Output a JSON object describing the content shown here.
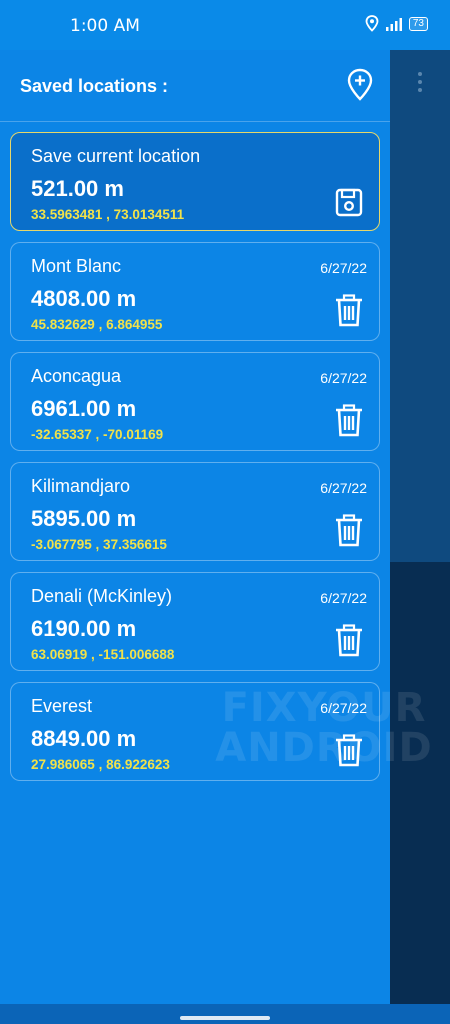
{
  "status_bar": {
    "time": "1:00 AM",
    "battery": "73",
    "icons": [
      "location-icon",
      "signal-icon",
      "battery-icon"
    ]
  },
  "drawer": {
    "title": "Saved locations :",
    "add_icon": "add-location-icon"
  },
  "current": {
    "name": "Save current location",
    "altitude": "521.00 m",
    "coords": "33.5963481 , 73.0134511",
    "action_icon": "save-icon"
  },
  "locations": [
    {
      "name": "Mont Blanc",
      "altitude": "4808.00 m",
      "coords": "45.832629 , 6.864955",
      "date": "6/27/22"
    },
    {
      "name": "Aconcagua",
      "altitude": "6961.00 m",
      "coords": "-32.65337 , -70.01169",
      "date": "6/27/22"
    },
    {
      "name": "Kilimandjaro",
      "altitude": "5895.00 m",
      "coords": "-3.067795 , 37.356615",
      "date": "6/27/22"
    },
    {
      "name": "Denali (McKinley)",
      "altitude": "6190.00 m",
      "coords": "63.06919 , -151.006688",
      "date": "6/27/22"
    },
    {
      "name": "Everest",
      "altitude": "8849.00 m",
      "coords": "27.986065 , 86.922623",
      "date": "6/27/22"
    }
  ],
  "watermark": {
    "line1": "FIXYOUR",
    "line2": "ANDROID"
  },
  "colors": {
    "drawer_bg": "#0c85e6",
    "coords": "#f1e24a",
    "current_border": "#e6d76a"
  }
}
